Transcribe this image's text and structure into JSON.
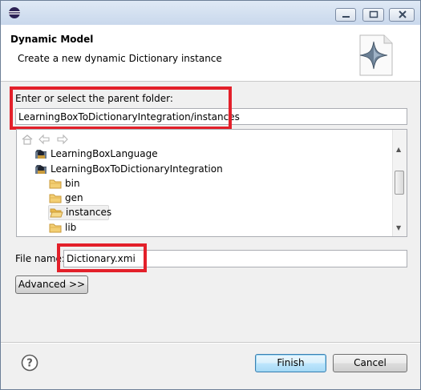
{
  "header": {
    "title": "Dynamic Model",
    "description": "Create a new dynamic Dictionary instance"
  },
  "folder": {
    "label": "Enter or select the parent folder:",
    "value": "LearningBoxToDictionaryIntegration/instances"
  },
  "tree": {
    "nav_icons": [
      "home-icon",
      "back-icon",
      "forward-icon"
    ],
    "items": [
      {
        "label": "LearningBoxLanguage",
        "icon": "project-icon"
      },
      {
        "label": "LearningBoxToDictionaryIntegration",
        "icon": "project-icon"
      },
      {
        "label": "bin",
        "icon": "folder-icon"
      },
      {
        "label": "gen",
        "icon": "folder-icon"
      },
      {
        "label": "instances",
        "icon": "folder-open-icon"
      },
      {
        "label": "lib",
        "icon": "folder-icon"
      }
    ]
  },
  "file": {
    "label": "File name:",
    "value": "Dictionary.xmi"
  },
  "buttons": {
    "advanced": "Advanced >>",
    "finish": "Finish",
    "cancel": "Cancel"
  },
  "colors": {
    "highlight_box": "#e3202a",
    "folder": "#e8b84a"
  }
}
